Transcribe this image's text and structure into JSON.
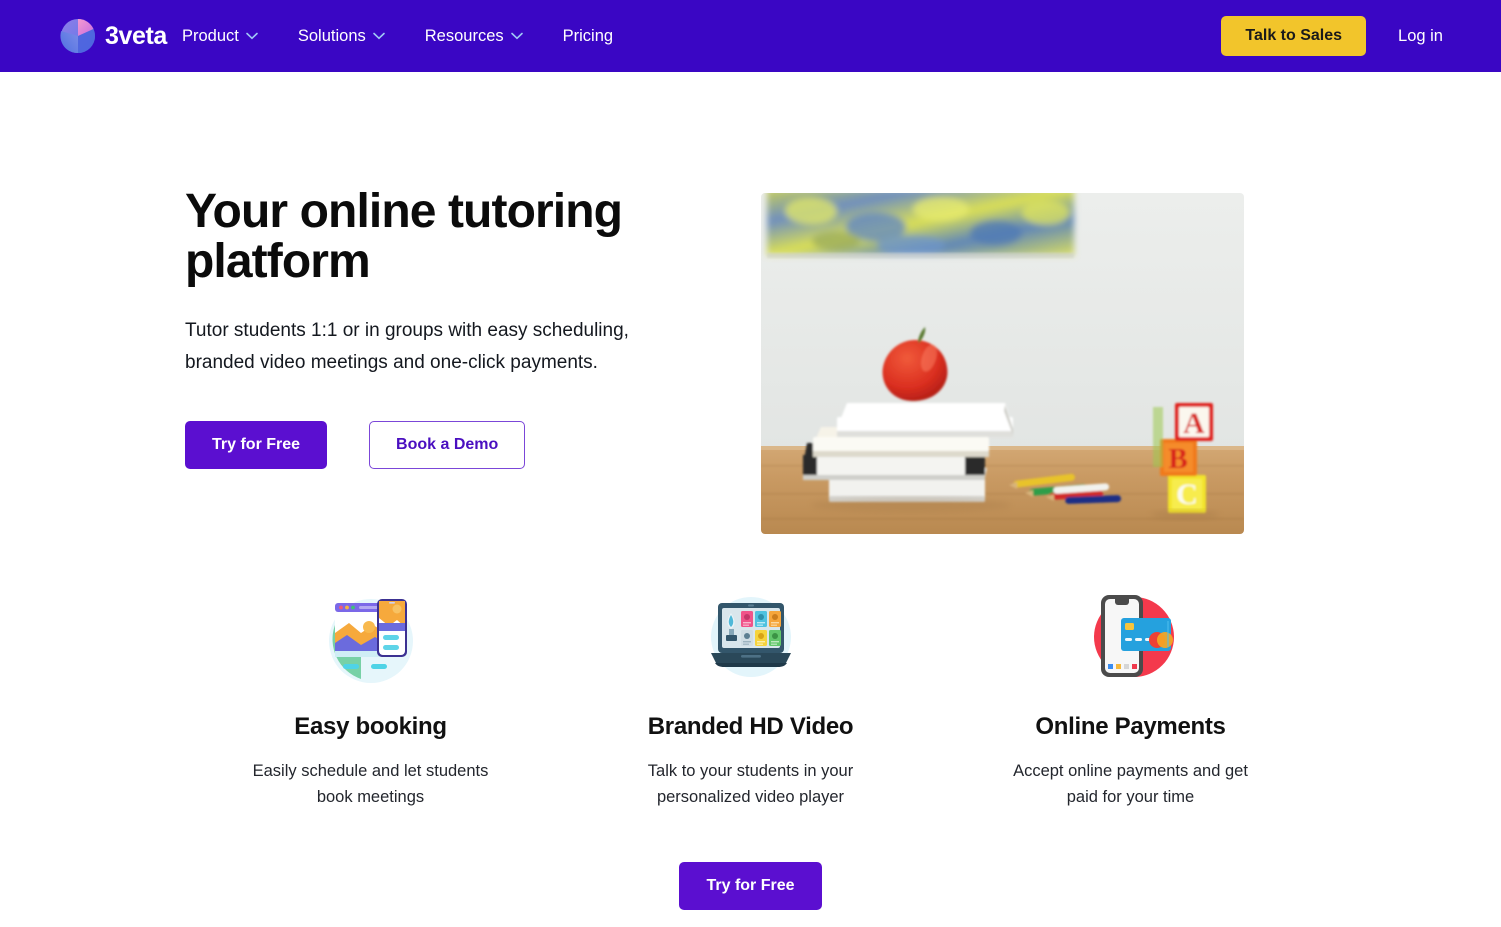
{
  "colors": {
    "nav_bg": "#3a06c4",
    "accent_purple": "#5b0fd0",
    "cta_yellow": "#f2c52b",
    "outline_purple": "#4a0fc0",
    "text_dark": "#0b0b0b"
  },
  "navbar": {
    "logo_text": "3veta",
    "logo_icon": "3veta-circle-logo",
    "links": [
      {
        "label": "Product",
        "has_dropdown": true,
        "icon": "chevron-down-icon"
      },
      {
        "label": "Solutions",
        "has_dropdown": true,
        "icon": "chevron-down-icon"
      },
      {
        "label": "Resources",
        "has_dropdown": true,
        "icon": "chevron-down-icon"
      },
      {
        "label": "Pricing",
        "has_dropdown": false,
        "icon": ""
      }
    ],
    "sales_button": "Talk to Sales",
    "login_link": "Log in"
  },
  "hero": {
    "title": "Your online tutoring platform",
    "subtitle": "Tutor students 1:1 or in groups with easy scheduling, branded video meetings and one-click payments.",
    "primary_cta": "Try for Free",
    "secondary_cta": "Book a Demo",
    "image_alt": "Stack of books with a red apple on top, colored pencils and ABC alphabet blocks on a wooden desk"
  },
  "features": [
    {
      "icon": "booking-browser-mobile-icon",
      "title": "Easy booking",
      "description": "Easily schedule and let students book meetings"
    },
    {
      "icon": "laptop-branding-pen-icon",
      "title": "Branded HD Video",
      "description": "Talk to your students in your personalized video player"
    },
    {
      "icon": "phone-credit-card-icon",
      "title": "Online Payments",
      "description": "Accept online payments and get paid for your time"
    }
  ],
  "bottom_cta": {
    "label": "Try for Free"
  }
}
